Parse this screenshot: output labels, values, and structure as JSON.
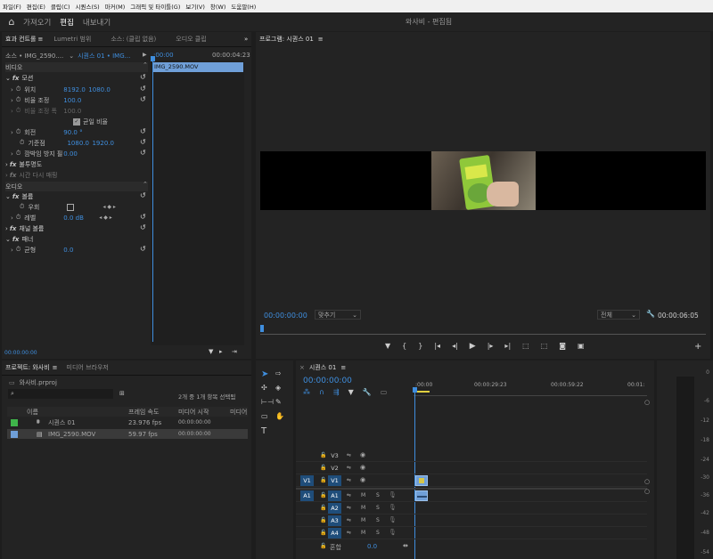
{
  "menu": [
    "파일(F)",
    "편집(E)",
    "클립(C)",
    "시퀀스(S)",
    "마커(M)",
    "그래픽 및 타이틀(G)",
    "보기(V)",
    "창(W)",
    "도움말(H)"
  ],
  "workspace": {
    "tabs": [
      "가져오기",
      "편집",
      "내보내기"
    ],
    "active_tab": "편집",
    "title": "와사비 - 편집됨"
  },
  "effect_controls": {
    "tabs": [
      "효과 컨트롤",
      "Lumetri 범위",
      "소스: (클립 없음)",
      "오디오 클립"
    ],
    "source_label": "소스 • IMG_2590....",
    "sequence_label": "시퀀스 01 • IMG...",
    "tc_start": ":00:00",
    "tc_end": "00:00:04:23",
    "clip_name": "IMG_2590.MOV",
    "video_header": "비디오",
    "motion": "모션",
    "position_label": "위치",
    "position_x": "8192.0",
    "position_y": "1080.0",
    "scale_label": "비율 조정",
    "scale_value": "100.0",
    "scale_width_label": "비율 조정 폭",
    "scale_width_value": "100.0",
    "uniform_label": "균일 비율",
    "rotation_label": "회전",
    "rotation_value": "90.0 °",
    "anchor_label": "기준점",
    "anchor_x": "1080.0",
    "anchor_y": "1920.0",
    "flicker_label": "깜박임 방지 필터",
    "flicker_value": "0.00",
    "opacity_label": "불투명도",
    "timeremap_label": "시간 다시 매핑",
    "audio_header": "오디오",
    "volume_label": "볼륨",
    "bypass_label": "우회",
    "level_label": "레벨",
    "level_value": "0.0 dB",
    "channel_label": "채널 볼륨",
    "panner_label": "패너",
    "balance_label": "균형",
    "balance_value": "0.0",
    "bottom_tc": "00:00:00:00"
  },
  "program": {
    "tab": "프로그램: 시퀀스 01",
    "timecode": "00:00:00:00",
    "fit": "맞추기",
    "quality": "전체",
    "duration": "00:00:06:05"
  },
  "project": {
    "tabs": [
      "프로젝트: 와사비",
      "미디어 브라우저"
    ],
    "file": "와사비.prproj",
    "selection_info": "2개 중 1개 항목 선택됨",
    "columns": [
      "이름",
      "프레임 속도",
      "미디어 시작",
      "미디어"
    ],
    "items": [
      {
        "name": "시퀀스 01",
        "fps": "23.976 fps",
        "start": "00:00:00:00",
        "color": "#3fb54a"
      },
      {
        "name": "IMG_2590.MOV",
        "fps": "59.97 fps",
        "start": "00:00:00:00",
        "color": "#6f9fd8"
      }
    ]
  },
  "timeline": {
    "tab": "시퀀스 01",
    "timecode": "00:00:00:00",
    "ruler": [
      ":00:00",
      "00:00:29:23",
      "00:00:59:22",
      "00:01:"
    ],
    "video_tracks": [
      "V3",
      "V2",
      "V1"
    ],
    "audio_tracks": [
      "A1",
      "A2",
      "A3",
      "A4"
    ],
    "source_v": "V1",
    "source_a": "A1",
    "master_label": "혼합",
    "master_value": "0.0",
    "m_label": "M",
    "s_label": "S"
  },
  "meter_ticks": [
    "0",
    "-6",
    "-12",
    "-18",
    "-24",
    "-30",
    "-36",
    "-42",
    "-48",
    "-54"
  ],
  "colors": {
    "accent": "#3f8ede",
    "panel": "#232323",
    "bg": "#1d1d1d",
    "clip": "#6f9fd8"
  }
}
